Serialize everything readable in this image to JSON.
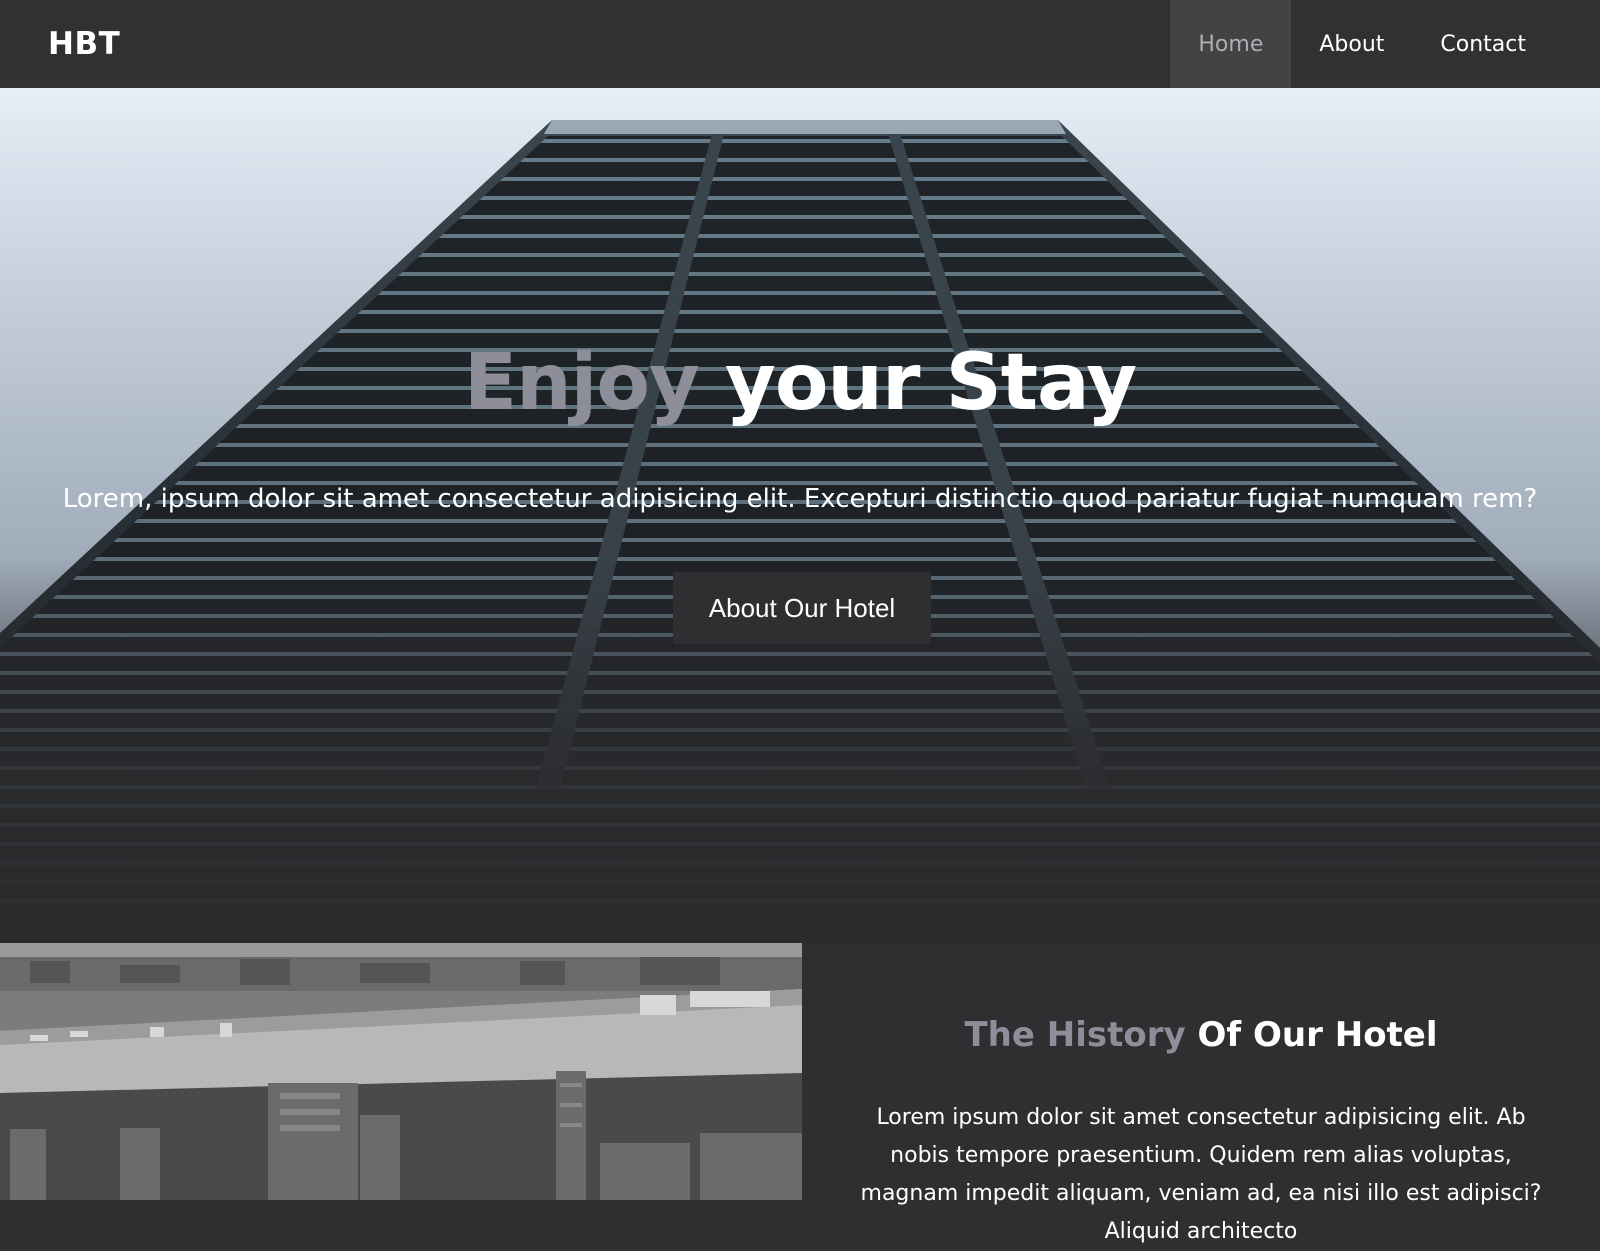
{
  "navbar": {
    "brand": "HBT",
    "links": [
      {
        "label": "Home",
        "active": true
      },
      {
        "label": "About",
        "active": false
      },
      {
        "label": "Contact",
        "active": false
      }
    ]
  },
  "hero": {
    "title_accent": "Enjoy",
    "title_rest": " your Stay",
    "subtitle": "Lorem, ipsum dolor sit amet consectetur adipisicing elit. Excepturi distinctio quod pariatur fugiat numquam rem?",
    "button_label": "About Our Hotel"
  },
  "history": {
    "title_accent": "The History",
    "title_rest": " Of Our Hotel",
    "body": "Lorem ipsum dolor sit amet consectetur adipisicing elit. Ab nobis tempore praesentium. Quidem rem alias voluptas, magnam impedit aliquam, veniam ad, ea nisi illo est adipisci? Aliquid architecto"
  },
  "colors": {
    "navbar_bg": "#313133",
    "nav_active_bg": "#434345",
    "accent_text": "#8d8e99",
    "section_bg": "#2f2f31"
  }
}
